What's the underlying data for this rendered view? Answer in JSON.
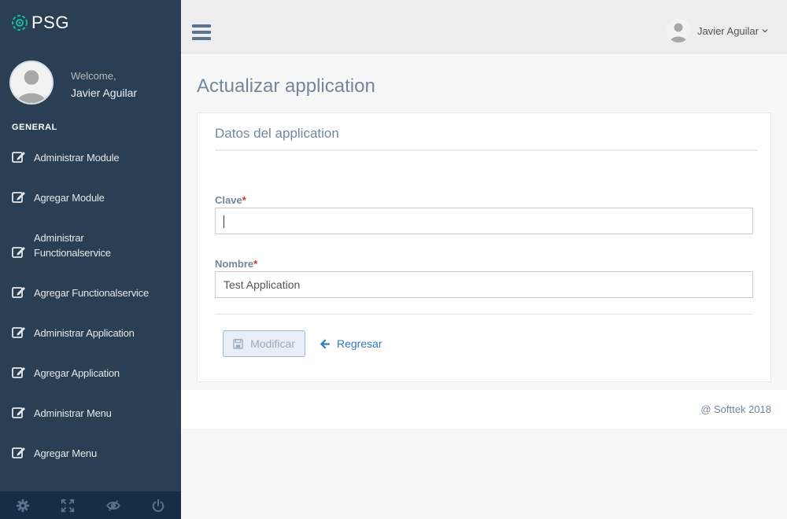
{
  "brand": {
    "name": "PSG",
    "icon": "target-icon"
  },
  "profile": {
    "welcome": "Welcome,",
    "name": "Javier Aguilar"
  },
  "sidebar": {
    "section_title": "GENERAL",
    "items": [
      {
        "label": "Administrar Module",
        "icon": "edit-icon"
      },
      {
        "label": "Agregar Module",
        "icon": "edit-icon"
      },
      {
        "label": "Administrar Functionalservice",
        "icon": "edit-icon"
      },
      {
        "label": "Agregar Functionalservice",
        "icon": "edit-icon"
      },
      {
        "label": "Administrar Application",
        "icon": "edit-icon"
      },
      {
        "label": "Agregar Application",
        "icon": "edit-icon"
      },
      {
        "label": "Administrar Menu",
        "icon": "edit-icon"
      },
      {
        "label": "Agregar Menu",
        "icon": "edit-icon"
      }
    ],
    "footer_icons": [
      "settings-icon",
      "fullscreen-icon",
      "lock-icon",
      "power-icon"
    ]
  },
  "topnav": {
    "user_name": "Javier Aguilar"
  },
  "page": {
    "title": "Actualizar application"
  },
  "panel": {
    "title": "Datos del application",
    "fields": {
      "clave": {
        "label": "Clave",
        "required_mark": "*",
        "value": ""
      },
      "nombre": {
        "label": "Nombre",
        "required_mark": "*",
        "value": "Test Application"
      }
    },
    "actions": {
      "save_label": "Modificar",
      "back_label": "Regresar"
    }
  },
  "footer": {
    "text": "@ Softtek 2018"
  },
  "colors": {
    "sidebar_bg": "#2a3f54",
    "sidebar_footer_bg": "#172d44",
    "accent_link": "#337ab7",
    "heading": "#73879c",
    "required": "#c9302c"
  }
}
